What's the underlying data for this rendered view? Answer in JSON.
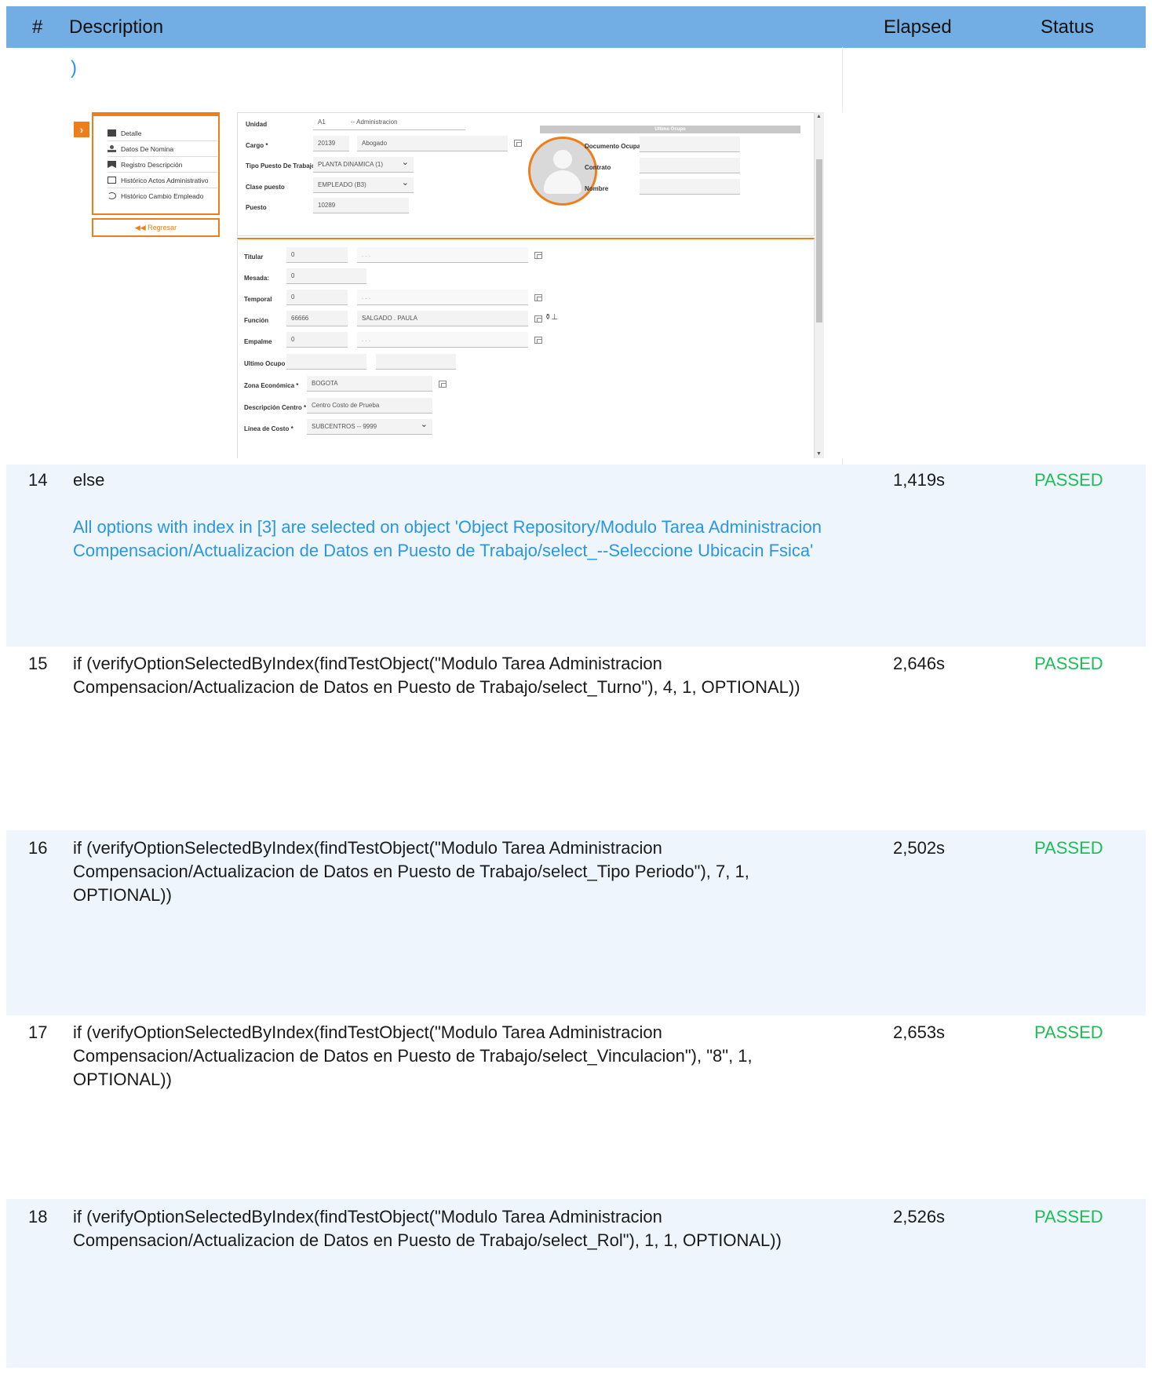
{
  "header": {
    "num": "#",
    "description": "Description",
    "elapsed": "Elapsed",
    "status": "Status"
  },
  "fragment": ")",
  "screenshot": {
    "sidebar": {
      "items": [
        "Detalle",
        "Datos De Nomina",
        "Registro Descripción",
        "Histórico Actos Administrativo",
        "Histórico Cambio Empleado"
      ],
      "back": "Regresar"
    },
    "upper": {
      "unidad": {
        "label": "Unidad",
        "code": "A1",
        "name": "-- Administracion"
      },
      "cargo": {
        "label": "Cargo *",
        "code": "20139",
        "name": "Abogado"
      },
      "tipo_puesto": {
        "label": "Tipo Puesto De Trabajo*",
        "value": "PLANTA DINAMICA (1)"
      },
      "clase_puesto": {
        "label": "Clase puesto",
        "value": "EMPLEADO (B3)"
      },
      "puesto": {
        "label": "Puesto",
        "value": "10289"
      },
      "ultimo_ocupo": {
        "title": "Ultimo Ocupo",
        "documento": "Documento Ocupa",
        "contrato": "Contrato",
        "nombre": "Nombre"
      }
    },
    "lower": {
      "titular": {
        "label": "Titular",
        "code": "0",
        "name": ". . ."
      },
      "mesada": {
        "label": "Mesada:",
        "code": "0"
      },
      "temporal": {
        "label": "Temporal",
        "code": "0",
        "name": ". . ."
      },
      "funcion": {
        "label": "Función",
        "code": "66666",
        "name": "SALGADO . PAULA"
      },
      "empalme": {
        "label": "Empalme",
        "code": "0",
        "name": ". . ."
      },
      "ultimo_ocupo": {
        "label": "Ultimo Ocupo"
      },
      "zona": {
        "label": "Zona Económica *",
        "value": "BOGOTA"
      },
      "descripcion_centro": {
        "label": "Descripción Centro *",
        "value": "Centro Costo de Prueba"
      },
      "linea_costo": {
        "label": "Línea de Costo *",
        "value": "SUBCENTROS -- 9999"
      }
    }
  },
  "rows": [
    {
      "num": "14",
      "description": "else",
      "elapsed": "1,419s",
      "status": "PASSED",
      "message": "All options with index in [3] are selected on object 'Object Repository/Modulo Tarea Administracion Compensacion/Actualizacion de Datos en Puesto de Trabajo/select_--Seleccione Ubicacin Fsica'"
    },
    {
      "num": "15",
      "description": "if (verifyOptionSelectedByIndex(findTestObject(\"Modulo Tarea Administracion Compensacion/Actualizacion de Datos en Puesto de Trabajo/select_Turno\"), 4, 1, OPTIONAL))",
      "elapsed": "2,646s",
      "status": "PASSED"
    },
    {
      "num": "16",
      "description": "if (verifyOptionSelectedByIndex(findTestObject(\"Modulo Tarea Administracion Compensacion/Actualizacion de Datos en Puesto de Trabajo/select_Tipo Periodo\"), 7, 1, OPTIONAL))",
      "elapsed": "2,502s",
      "status": "PASSED"
    },
    {
      "num": "17",
      "description": "if (verifyOptionSelectedByIndex(findTestObject(\"Modulo Tarea Administracion Compensacion/Actualizacion de Datos en Puesto de Trabajo/select_Vinculacion\"), \"8\", 1, OPTIONAL))",
      "elapsed": "2,653s",
      "status": "PASSED"
    },
    {
      "num": "18",
      "description": "if (verifyOptionSelectedByIndex(findTestObject(\"Modulo Tarea Administracion Compensacion/Actualizacion de Datos en Puesto de Trabajo/select_Rol\"), 1, 1, OPTIONAL))",
      "elapsed": "2,526s",
      "status": "PASSED"
    }
  ],
  "colors": {
    "header": "#72ade4",
    "stripe": "#eef5fd",
    "passed": "#1dbe55",
    "link": "#2b96e3",
    "accent": "#ef7d1a"
  }
}
